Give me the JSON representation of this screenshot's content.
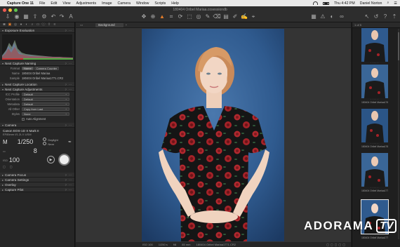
{
  "menubar": {
    "app": "Capture One 11",
    "items": [
      "File",
      "Edit",
      "View",
      "Adjustments",
      "Image",
      "Camera",
      "Window",
      "Scripts",
      "Help"
    ],
    "time": "Thu 4:42 PM",
    "user": "Daniel Norton"
  },
  "window": {
    "title": "180404 Oribel Mariaa.cosessiondb"
  },
  "left_panel": {
    "tool_tabs": [
      "camera-tab",
      "capture-tab",
      "lens-tab",
      "color-tab",
      "exposure-tab",
      "details-tab",
      "adjust-tab",
      "metadata-tab",
      "output-tab",
      "batch-tab"
    ],
    "exposure_evaluation": "Exposure Evaluation",
    "next_capture_naming": {
      "header": "Next Capture Naming",
      "format_label": "Format",
      "format_options": [
        "Name",
        "Camera Counter"
      ],
      "name_label": "Name",
      "name_value": "180404 Oribel Mariaa",
      "sample_label": "Sample",
      "sample_value": "180404 Oribel Mariaa1771.CR2"
    },
    "next_capture_location": "Next Capture Location",
    "next_capture_adjustments": {
      "header": "Next Capture Adjustments",
      "rows": [
        {
          "label": "ICC Profile",
          "value": "Default"
        },
        {
          "label": "Orientation",
          "value": "Default"
        },
        {
          "label": "Metadata",
          "value": "Default"
        },
        {
          "label": "All Other",
          "value": "Copy from Last"
        },
        {
          "label": "Styles",
          "value": "None"
        }
      ],
      "auto_align": "Auto Alignment"
    },
    "camera": {
      "header": "Camera",
      "model": "Canon EOS-1D X Mark II",
      "lens": "EF85mm f/1.2L II USM",
      "mode": "M",
      "shutter": "1/250",
      "aperture": "8",
      "iso": "100",
      "wb_label": "Daylight",
      "focus_label": "Near"
    },
    "collapsed_sections": [
      "Camera Focus",
      "Camera Settings",
      "Overlay",
      "Capture Pilot"
    ]
  },
  "viewer": {
    "tab_label": "Background",
    "status": {
      "iso": "ISO 100",
      "shutter": "1/250 s",
      "aperture": "f/8",
      "focal": "85 mm",
      "filename": "180404 Oribel Mariaa1771.CR2"
    }
  },
  "browser": {
    "counter": "1 of 5",
    "thumbs": [
      {
        "name": "180404 Oribel Mariaa1767.CR2"
      },
      {
        "name": "180404 Oribel Mariaa1768.CR2"
      },
      {
        "name": "180404 Oribel Mariaa1769.CR2"
      },
      {
        "name": "180404 Oribel Mariaa1770.CR2"
      },
      {
        "name": "180404 Oribel Mariaa1771.CR2"
      }
    ]
  },
  "watermark": {
    "brand": "ADORAMA",
    "tv": "TV"
  },
  "colors": {
    "accent": "#e07b2a",
    "backdrop_blue": "#2f5a8e",
    "dress_black": "#141414",
    "rose_red": "#b3282e"
  }
}
